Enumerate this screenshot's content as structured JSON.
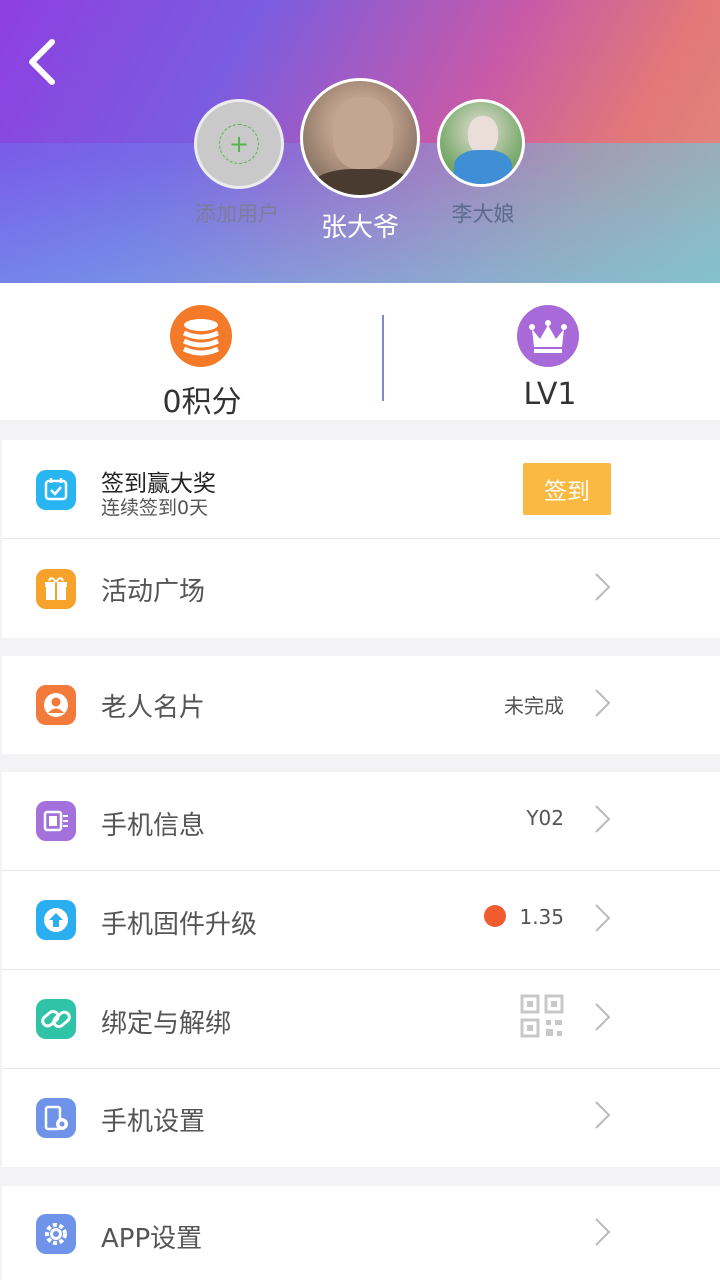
{
  "header": {
    "users": [
      {
        "name": "添加用户",
        "type": "add"
      },
      {
        "name": "张大爷",
        "type": "current"
      },
      {
        "name": "李大娘",
        "type": "other"
      }
    ]
  },
  "stats": {
    "points_label": "0积分",
    "level_label": "LV1"
  },
  "signin": {
    "title": "签到赢大奖",
    "subtitle": "连续签到0天",
    "button": "签到"
  },
  "menu": {
    "activity": {
      "label": "活动广场"
    },
    "card": {
      "label": "老人名片",
      "value": "未完成"
    },
    "phone_info": {
      "label": "手机信息",
      "value": "Y02"
    },
    "firmware": {
      "label": "手机固件升级",
      "value": "1.35"
    },
    "bind": {
      "label": "绑定与解绑"
    },
    "phone_settings": {
      "label": "手机设置"
    },
    "app_settings": {
      "label": "APP设置"
    }
  },
  "colors": {
    "signin_button": "#f9b942",
    "coin": "#f47a2a",
    "crown": "#a86ad8",
    "update_dot": "#f25b2f"
  },
  "icons": [
    "back-arrow-icon",
    "add-icon",
    "coin-stack-icon",
    "crown-icon",
    "calendar-check-icon",
    "gift-icon",
    "person-card-icon",
    "phone-info-icon",
    "upload-icon",
    "link-icon",
    "qr-code-icon",
    "phone-settings-icon",
    "gear-icon",
    "chevron-right-icon"
  ]
}
